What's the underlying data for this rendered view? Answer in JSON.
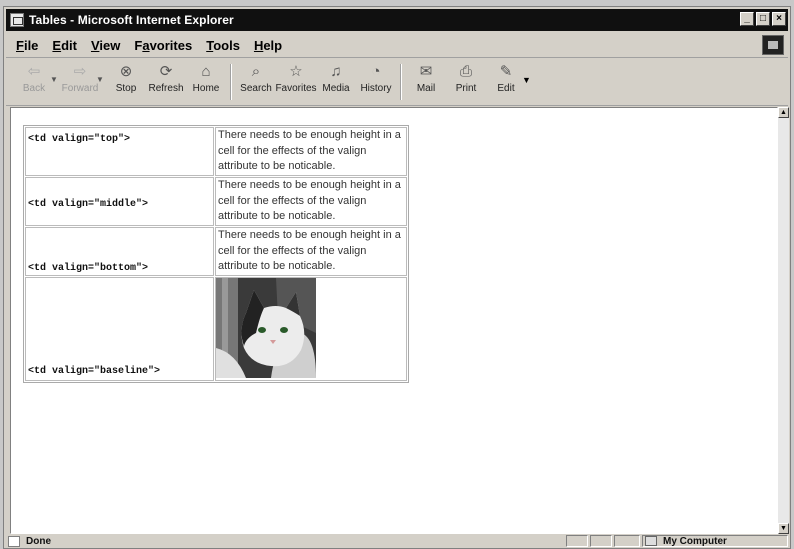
{
  "window": {
    "title": "Tables - Microsoft Internet Explorer"
  },
  "menu": [
    {
      "label": "File",
      "key": "F",
      "rest": "ile"
    },
    {
      "label": "Edit",
      "key": "E",
      "rest": "dit"
    },
    {
      "label": "View",
      "key": "V",
      "rest": "iew"
    },
    {
      "label": "Favorites",
      "key": "a",
      "pre": "F",
      "rest": "vorites"
    },
    {
      "label": "Tools",
      "key": "T",
      "rest": "ools"
    },
    {
      "label": "Help",
      "key": "H",
      "rest": "elp"
    }
  ],
  "toolbar": {
    "back": "Back",
    "forward": "Forward",
    "stop": "Stop",
    "refresh": "Refresh",
    "home": "Home",
    "search": "Search",
    "favorites": "Favorites",
    "media": "Media",
    "history": "History",
    "mail": "Mail",
    "print": "Print",
    "edit": "Edit"
  },
  "icons": {
    "back": "back-arrow-icon",
    "forward": "forward-arrow-icon",
    "stop": "stop-icon",
    "refresh": "refresh-icon",
    "home": "home-icon",
    "search": "search-icon",
    "favorites": "favorites-icon",
    "media": "media-icon",
    "history": "history-icon",
    "mail": "mail-icon",
    "print": "print-icon",
    "edit": "edit-icon"
  },
  "table": {
    "rows": [
      {
        "code": "<td valign=\"top\">",
        "text": "There needs to be enough height in a cell for the effects of the valign attribute to be noticable."
      },
      {
        "code": "<td valign=\"middle\">",
        "text": "There needs to be enough height in a cell for the effects of the valign attribute to be noticable."
      },
      {
        "code": "<td valign=\"bottom\">",
        "text": "There needs to be enough height in a cell for the effects of the valign attribute to be noticable."
      },
      {
        "code": "<td valign=\"baseline\">"
      }
    ]
  },
  "status": {
    "text": "Done",
    "zone": "My Computer"
  }
}
